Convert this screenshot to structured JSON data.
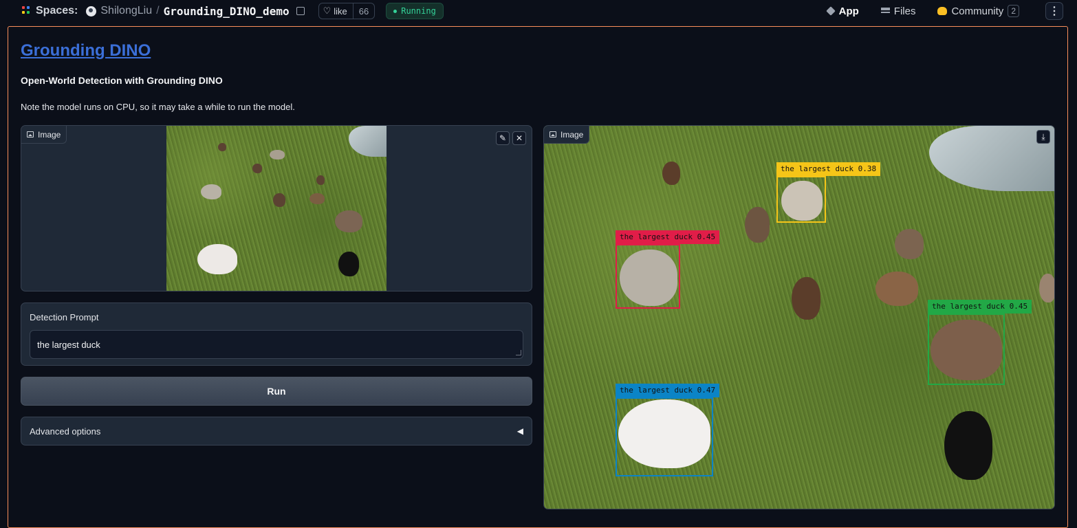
{
  "topbar": {
    "spaces_label": "Spaces:",
    "owner": "ShilongLiu",
    "separator": "/",
    "repo": "Grounding_DINO_demo",
    "like_label": "like",
    "like_count": "66",
    "status": "Running",
    "tabs": [
      {
        "label": "App",
        "icon": "cube-icon",
        "active": true
      },
      {
        "label": "Files",
        "icon": "files-icon",
        "active": false
      },
      {
        "label": "Community",
        "icon": "community-icon",
        "active": false,
        "badge": "2"
      }
    ],
    "menu_glyph": "⋮"
  },
  "app": {
    "title": "Grounding DINO",
    "subtitle": "Open-World Detection with Grounding DINO",
    "note": "Note the model runs on CPU, so it may take a while to run the model.",
    "input_image_label": "Image",
    "output_image_label": "Image",
    "prompt_label": "Detection Prompt",
    "prompt_value": "the largest duck",
    "run_label": "Run",
    "advanced_label": "Advanced options",
    "advanced_glyph": "◀",
    "edit_glyph": "✎",
    "close_glyph": "✕",
    "download_glyph": "⤓"
  },
  "detections": [
    {
      "label": "the largest duck 0.38",
      "color": "#f5c518",
      "text_color": "#111111"
    },
    {
      "label": "the largest duck 0.45",
      "color": "#e11d48",
      "text_color": "#111111"
    },
    {
      "label": "the largest duck 0.45",
      "color": "#22a846",
      "text_color": "#111111"
    },
    {
      "label": "the largest duck 0.47",
      "color": "#0b84c6",
      "text_color": "#111111"
    }
  ],
  "colors": {
    "accent_border": "#fb8f5b",
    "title_link": "#3b6fd8",
    "status_green": "#34d399"
  }
}
